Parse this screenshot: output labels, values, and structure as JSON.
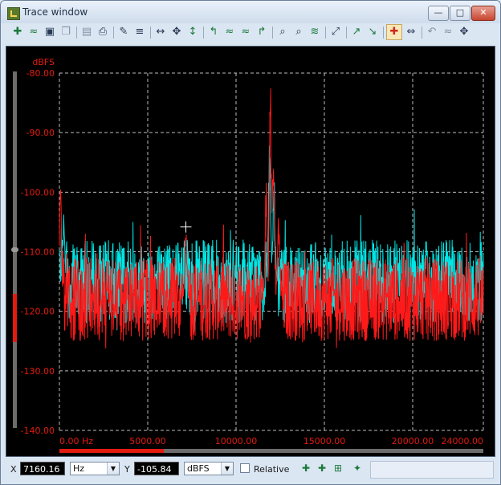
{
  "window": {
    "title": "Trace window"
  },
  "toolbar": {
    "icons": [
      "add-trace-icon",
      "remove-trace-icon",
      "save-icon",
      "copy-icon",
      "print-preview-icon",
      "print-icon",
      "edit-icon",
      "list-icon",
      "zoom-x-icon",
      "zoom-xy-icon",
      "zoom-y-icon",
      "peak-left-icon",
      "peak-down-icon",
      "peak-up-icon",
      "peak-right-icon",
      "marker-find-icon",
      "marker-find-next-icon",
      "marker-level-icon",
      "autoscale-icon",
      "trace-up-icon",
      "trace-down-icon",
      "marker-toggle-icon",
      "marker-delta-icon",
      "undo-icon",
      "redo-icon",
      "settings-icon"
    ]
  },
  "chart_data": {
    "type": "line",
    "ylabel": "dBFS",
    "yticks": [
      "-80.00",
      "-90.00",
      "-100.00",
      "-110.00",
      "-120.00",
      "-130.00",
      "-140.00"
    ],
    "ylim": [
      -143,
      -80
    ],
    "xticks": [
      "0.00 Hz",
      "5000.00",
      "10000.00",
      "15000.00",
      "20000.00",
      "24000.00"
    ],
    "xtick_values": [
      0,
      5000,
      10000,
      15000,
      20000,
      24000
    ],
    "xlim": [
      0,
      24000
    ],
    "grid": true,
    "series": [
      {
        "color": "#00e5e5",
        "floor": -115,
        "noise": 7,
        "peaks": [
          [
            11900,
            -90
          ],
          [
            12150,
            -97
          ],
          [
            250,
            -103
          ]
        ]
      },
      {
        "color": "#ff1a1a",
        "floor": -118,
        "noise": 7,
        "peaks": [
          [
            11950,
            -80
          ],
          [
            12100,
            -90
          ],
          [
            7160,
            -105.84
          ],
          [
            11700,
            -98
          ],
          [
            12400,
            -103
          ],
          [
            50,
            -97
          ]
        ]
      }
    ],
    "cursor": {
      "x": 7160.16,
      "y": -105.84,
      "color": "#ffffff"
    },
    "label_color": "#e31b0f",
    "grid_color": "#bdbdbd"
  },
  "status": {
    "x_label": "X",
    "x_value": "7160.16",
    "x_unit": "Hz",
    "y_label": "Y",
    "y_value": "-105.84",
    "y_unit": "dBFS",
    "relative_label": "Relative",
    "relative_checked": false,
    "icons": [
      "add-marker-icon",
      "marker-peak-icon",
      "marker-grid-icon",
      "marker-settings-icon"
    ]
  }
}
